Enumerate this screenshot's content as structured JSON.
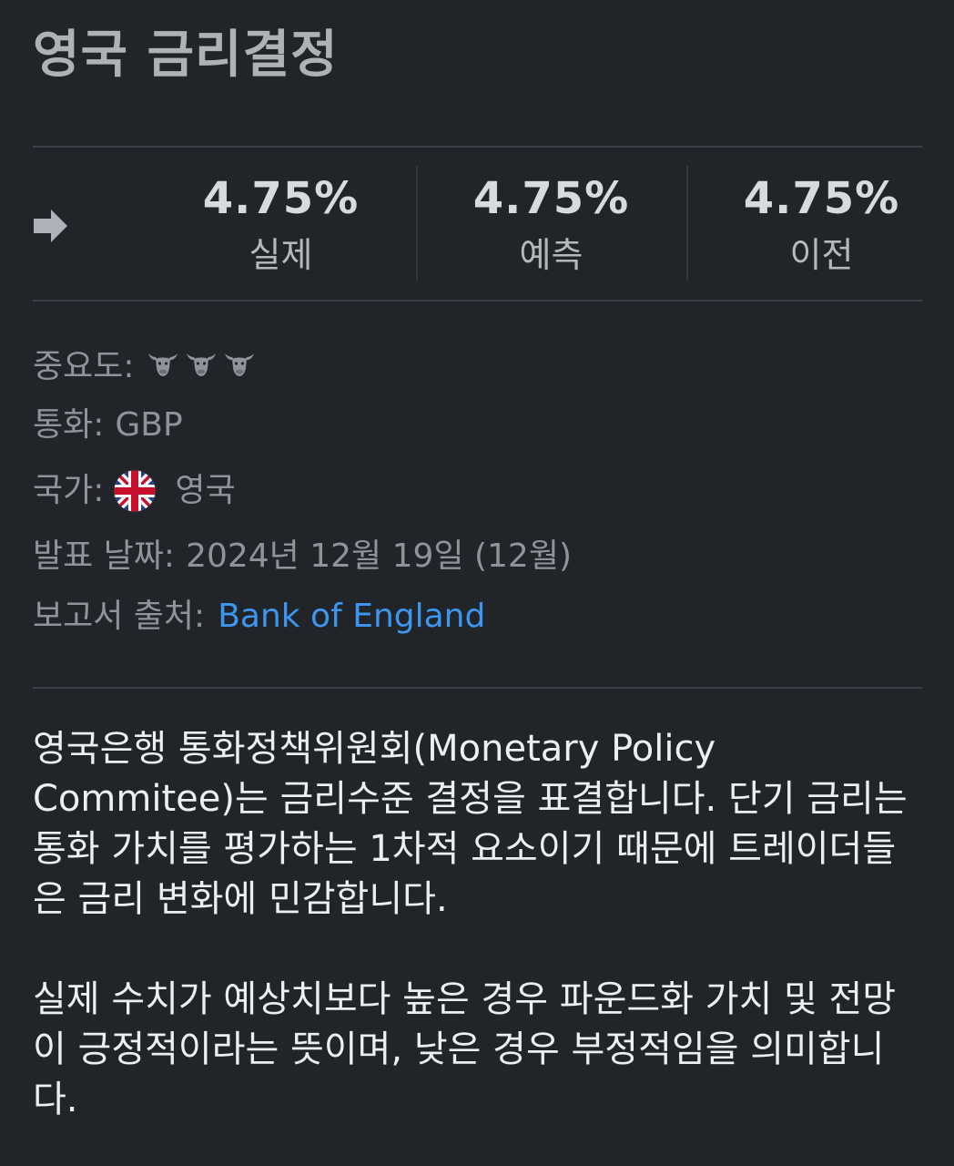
{
  "title": "영국 금리결정",
  "trend_icon": "right-arrow-icon",
  "stats": [
    {
      "value": "4.75%",
      "label": "실제"
    },
    {
      "value": "4.75%",
      "label": "예측"
    },
    {
      "value": "4.75%",
      "label": "이전"
    }
  ],
  "meta": {
    "importance_label": "중요도:",
    "importance_level": 3,
    "importance_icon": "bull-icon",
    "currency_label": "통화:",
    "currency_value": "GBP",
    "country_label": "국가:",
    "country_flag": "uk-flag-icon",
    "country_value": "영국",
    "release_label": "발표 날짜:",
    "release_value": "2024년 12월 19일 (12월)",
    "source_label": "보고서 출처:",
    "source_value": "Bank of England"
  },
  "description": {
    "paragraph1": "영국은행 통화정책위원회(Monetary Policy Commitee)는 금리수준 결정을 표결합니다. 단기 금리는 통화 가치를 평가하는 1차적 요소이기 때문에 트레이더들은 금리 변화에 민감합니다.",
    "paragraph2": "실제 수치가 예상치보다 높은 경우 파운드화 가치 및 전망이 긍정적이라는 뜻이며, 낮은 경우 부정적임을 의미합니다."
  },
  "colors": {
    "background": "#212429",
    "link": "#3d96ef",
    "muted_text": "#8f939a"
  }
}
